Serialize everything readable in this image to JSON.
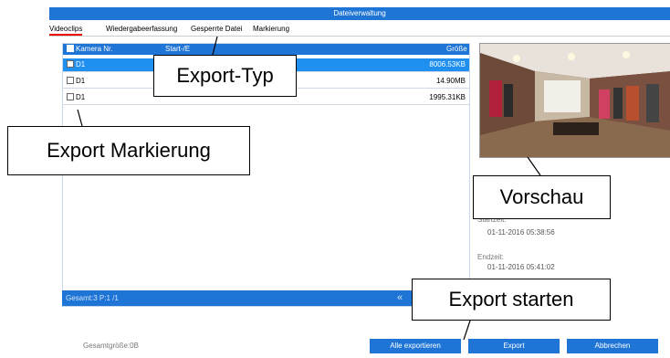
{
  "window": {
    "title": "Dateiverwaltung"
  },
  "tabs": [
    {
      "label": "Videoclips"
    },
    {
      "label": "Wiedergabeerfassung"
    },
    {
      "label": "Gesperrte Datei"
    },
    {
      "label": "Markierung"
    }
  ],
  "table": {
    "columns": [
      "Kamera Nr.",
      "Start-/E",
      "Größe"
    ],
    "rows": [
      {
        "camera": "D1",
        "size": "8006.53KB",
        "selected": true
      },
      {
        "camera": "D1",
        "size": "14.90MB",
        "selected": false
      },
      {
        "camera": "D1",
        "size": "1995.31KB",
        "selected": false
      }
    ],
    "footer": "Gesamt:3 P:1 /1",
    "prev_icon": "«"
  },
  "details": {
    "start_label": "Startzeit:",
    "start_value": "01-11-2016 05:38:56",
    "end_label": "Endzeit:",
    "end_value": "01-11-2016 05:41:02"
  },
  "total_size": "Gesamtgröße:0B",
  "buttons": {
    "export_all": "Alle exportieren",
    "export": "Export",
    "cancel": "Abbrechen"
  },
  "callouts": {
    "export_type": "Export-Typ",
    "export_mark": "Export Markierung",
    "preview": "Vorschau",
    "export_start": "Export starten"
  },
  "colors": {
    "accent": "#1f75d6",
    "selected_row": "#1f8ff0",
    "active_tab_underline": "#e00000"
  }
}
